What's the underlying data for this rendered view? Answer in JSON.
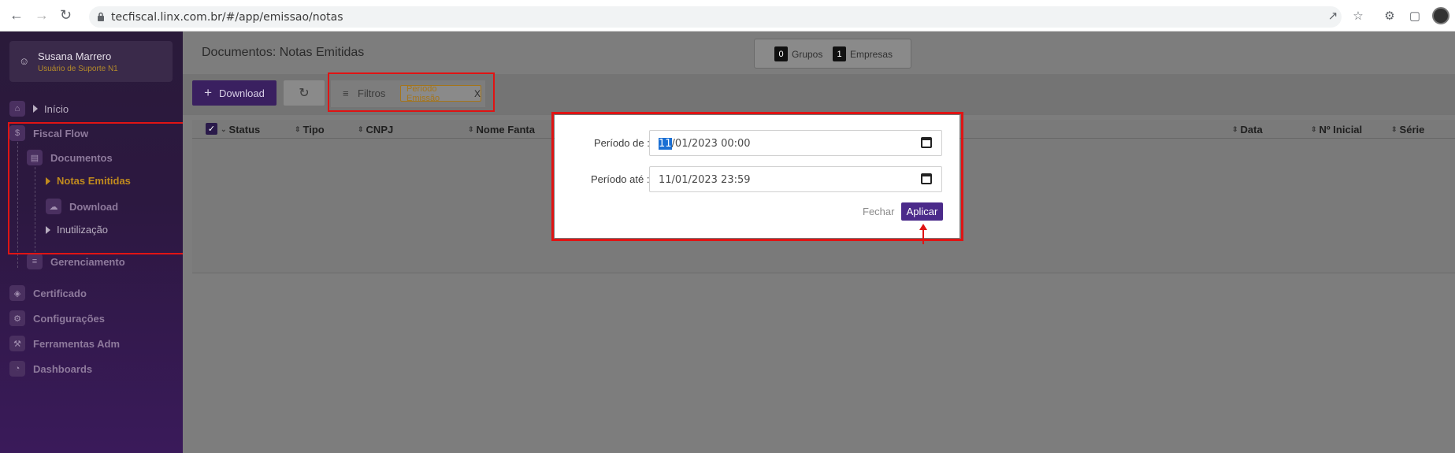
{
  "browser": {
    "url": "tecfiscal.linx.com.br/#/app/emissao/notas"
  },
  "sidebar": {
    "user": {
      "name": "Susana Marrero",
      "role": "Usuário de Suporte N1"
    },
    "items": [
      {
        "label": "Início"
      },
      {
        "label": "Fiscal Flow"
      },
      {
        "label": "Documentos"
      },
      {
        "label": "Notas Emitidas"
      },
      {
        "label": "Download"
      },
      {
        "label": "Inutilização"
      },
      {
        "label": "Gerenciamento"
      },
      {
        "label": "Certificado"
      },
      {
        "label": "Configurações"
      },
      {
        "label": "Ferramentas Adm"
      },
      {
        "label": "Dashboards"
      }
    ]
  },
  "header": {
    "title": "Documentos: Notas Emitidas",
    "grupos_count": "0",
    "grupos_label": "Grupos",
    "empresas_count": "1",
    "empresas_label": "Empresas"
  },
  "toolbar": {
    "download_label": "Download",
    "filters_label": "Filtros",
    "chip_label": "Período Emissão",
    "chip_close": "X"
  },
  "table": {
    "columns": [
      "Status",
      "Tipo",
      "CNPJ",
      "Nome Fanta",
      "Data",
      "Nº Inicial",
      "Série"
    ]
  },
  "modal": {
    "from_label": "Período de :",
    "from_value_sel": "11",
    "from_value_rest": "/01/2023 00:00",
    "to_label": "Período até :",
    "to_value": "11/01/2023 23:59",
    "close_label": "Fechar",
    "apply_label": "Aplicar"
  },
  "colors": {
    "accent": "#4b2a8a",
    "active_menu": "#c08a1e",
    "highlight": "#e01414"
  }
}
